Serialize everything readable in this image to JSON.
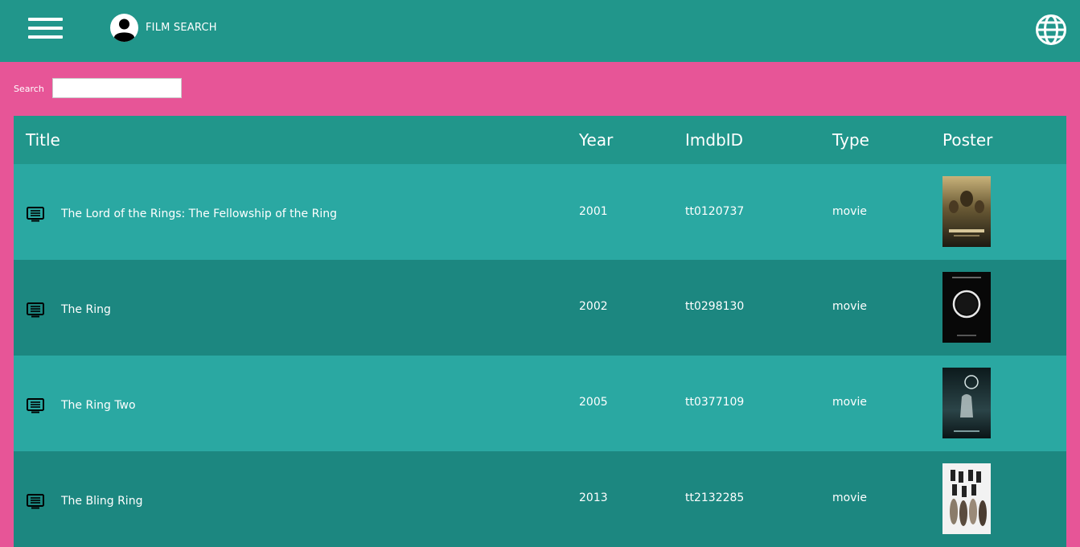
{
  "header": {
    "title": "FILM SEARCH",
    "icons": [
      "menu-icon",
      "account-circle-icon",
      "globe-icon"
    ],
    "background": "#21968b"
  },
  "search": {
    "label": "Search",
    "value": "",
    "placeholder": ""
  },
  "colors": {
    "page_background": "#e75597",
    "header": "#21968b",
    "row_light": "#2aa8a2",
    "row_dark": "#1c8780"
  },
  "table": {
    "columns": [
      "Title",
      "Year",
      "ImdbID",
      "Type",
      "Poster"
    ],
    "rows": [
      {
        "title": "The Lord of the Rings: The Fellowship of the Ring",
        "year": "2001",
        "imdbid": "tt0120737",
        "type": "movie",
        "poster": "poster-lotr"
      },
      {
        "title": "The Ring",
        "year": "2002",
        "imdbid": "tt0298130",
        "type": "movie",
        "poster": "poster-ring"
      },
      {
        "title": "The Ring Two",
        "year": "2005",
        "imdbid": "tt0377109",
        "type": "movie",
        "poster": "poster-ring-two"
      },
      {
        "title": "The Bling Ring",
        "year": "2013",
        "imdbid": "tt2132285",
        "type": "movie",
        "poster": "poster-bling-ring"
      }
    ]
  }
}
